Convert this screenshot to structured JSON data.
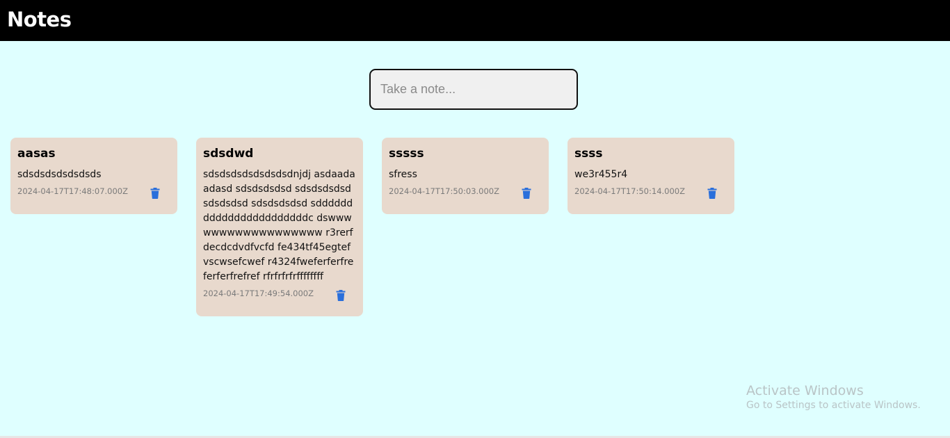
{
  "header": {
    "title": "Notes"
  },
  "composer": {
    "placeholder": "Take a note..."
  },
  "notes": [
    {
      "title": "aasas",
      "body": "sdsdsdsdsdsdsds",
      "date": "2024-04-17T17:48:07.000Z",
      "delete_icon": "trash-icon"
    },
    {
      "title": "sdsdwd",
      "body": "sdsdsdsdsdsdsdsdnjdj asdaadaadasd sdsdsdsdsd sdsdsdsdsdsdsdsdsd sdsdsdsdsd sdddddddddddddddddddddddc dswwwwwwwwwwwwwwwwww r3rerfdecdcdvdfvcfd fe434tf45egtefvscwsefcwef r4324fweferferfreferferfrefref rfrfrfrfrffffffff",
      "date": "2024-04-17T17:49:54.000Z",
      "delete_icon": "trash-icon"
    },
    {
      "title": "sssss",
      "body": "sfress",
      "date": "2024-04-17T17:50:03.000Z",
      "delete_icon": "trash-icon"
    },
    {
      "title": "ssss",
      "body": "we3r455r4",
      "date": "2024-04-17T17:50:14.000Z",
      "delete_icon": "trash-icon"
    }
  ],
  "watermark": {
    "title": "Activate Windows",
    "subtitle": "Go to Settings to activate Windows."
  },
  "colors": {
    "page_background": "#dfffff",
    "header_background": "#000000",
    "card_background": "#e8d9cd",
    "delete_icon": "#2a6fdb"
  }
}
